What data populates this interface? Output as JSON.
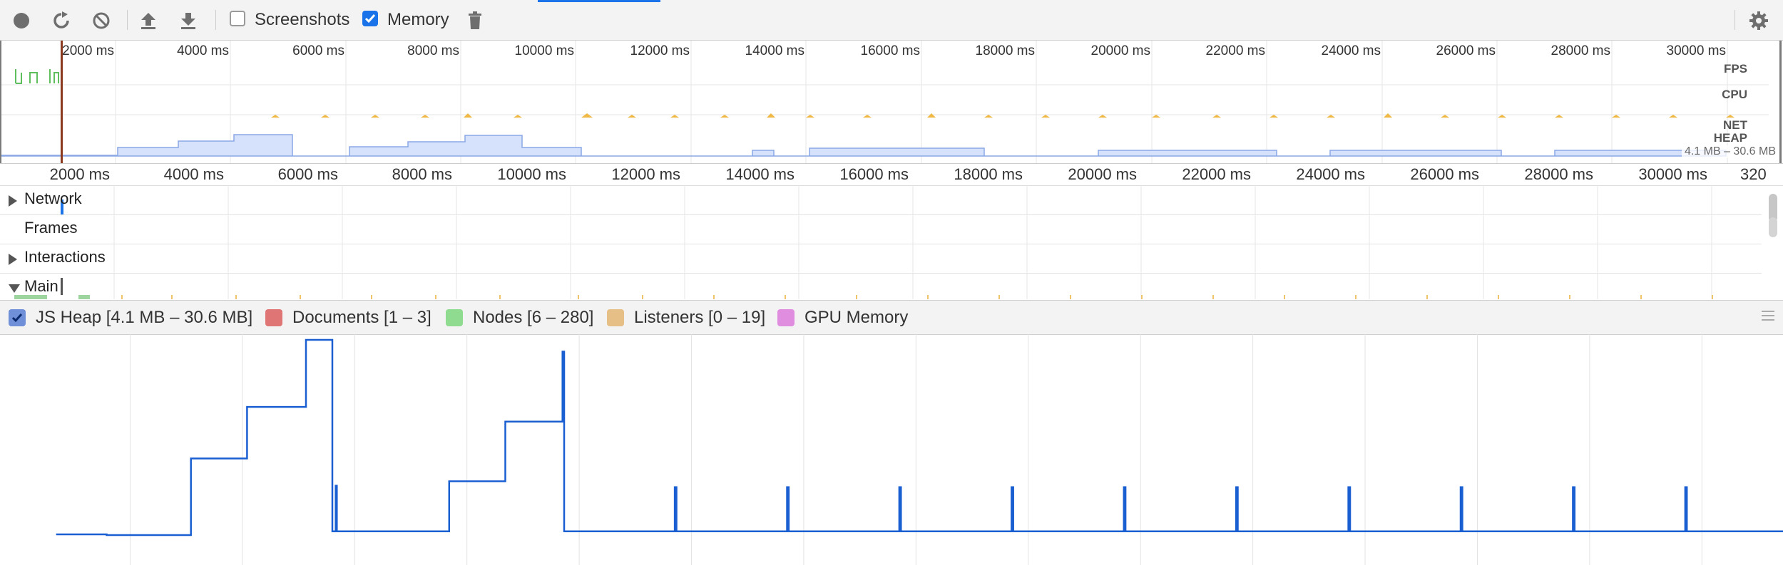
{
  "toolbar": {
    "screenshots_label": "Screenshots",
    "screenshots_checked": false,
    "memory_label": "Memory",
    "memory_checked": true,
    "icons": [
      "record-icon",
      "reload-icon",
      "clear-icon",
      "upload-icon",
      "download-icon",
      "trash-icon",
      "gear-icon"
    ]
  },
  "overview": {
    "ticks": [
      "2000 ms",
      "4000 ms",
      "6000 ms",
      "8000 ms",
      "10000 ms",
      "12000 ms",
      "14000 ms",
      "16000 ms",
      "18000 ms",
      "20000 ms",
      "22000 ms",
      "24000 ms",
      "26000 ms",
      "28000 ms",
      "30000 ms"
    ],
    "lanes": [
      "FPS",
      "CPU",
      "NET",
      "HEAP"
    ],
    "heap_range": "4.1 MB – 30.6 MB"
  },
  "timeline": {
    "ticks": [
      "2000 ms",
      "4000 ms",
      "6000 ms",
      "8000 ms",
      "10000 ms",
      "12000 ms",
      "14000 ms",
      "16000 ms",
      "18000 ms",
      "20000 ms",
      "22000 ms",
      "24000 ms",
      "26000 ms",
      "28000 ms",
      "30000 ms",
      "320"
    ],
    "tracks": [
      {
        "label": "Network",
        "expand": "collapsed"
      },
      {
        "label": "Frames",
        "expand": "none"
      },
      {
        "label": "Interactions",
        "expand": "collapsed"
      },
      {
        "label": "Main",
        "expand": "expanded"
      }
    ]
  },
  "counters": {
    "items": [
      {
        "label": "JS Heap [4.1 MB – 30.6 MB]",
        "color": "#1a5fd1",
        "checked": true
      },
      {
        "label": "Documents [1 – 3]",
        "color": "#e07575",
        "checked": false
      },
      {
        "label": "Nodes [6 – 280]",
        "color": "#8fdb8f",
        "checked": false
      },
      {
        "label": "Listeners [0 – 19]",
        "color": "#e6bf86",
        "checked": false
      },
      {
        "label": "GPU Memory",
        "color": "#e08ddf",
        "checked": false
      }
    ]
  },
  "chart_data": {
    "type": "line",
    "title": "",
    "xlabel": "",
    "ylabel": "",
    "series": [
      {
        "name": "JS Heap",
        "x": [
          1000,
          1800,
          1900,
          3400,
          3401,
          4400,
          4401,
          5450,
          5451,
          5900,
          5920,
          5980,
          6000,
          8000,
          8001,
          9000,
          9001,
          10000,
          10020,
          10050,
          10080,
          12000,
          12020,
          12050,
          12080,
          14000,
          14020,
          14050,
          14080,
          16000,
          16020,
          16050,
          16080,
          18000,
          18020,
          18050,
          18080,
          20000,
          20020,
          20050,
          20080,
          22000,
          22020,
          22050,
          22080,
          24000,
          24020,
          24050,
          24080,
          26000,
          26020,
          26050,
          26080,
          28000,
          28020,
          28050,
          28080,
          30000,
          30020,
          30050,
          30080,
          32000
        ],
        "values": [
          4.2,
          4.2,
          4.1,
          4.1,
          14.5,
          14.5,
          21.5,
          21.5,
          30.6,
          30.6,
          4.6,
          10.8,
          4.6,
          4.6,
          11.4,
          11.4,
          19.5,
          19.5,
          29.0,
          4.6,
          4.6,
          4.6,
          10.6,
          4.6,
          4.6,
          4.6,
          10.6,
          4.6,
          4.6,
          4.6,
          10.6,
          4.6,
          4.6,
          4.6,
          10.6,
          4.6,
          4.6,
          4.6,
          10.6,
          4.6,
          4.6,
          4.6,
          10.6,
          4.6,
          4.6,
          4.6,
          10.6,
          4.6,
          4.6,
          4.6,
          10.6,
          4.6,
          4.6,
          4.6,
          10.6,
          4.6,
          4.6,
          4.6,
          10.6,
          4.6,
          4.6,
          4.6
        ]
      }
    ],
    "ylim": [
      4.1,
      30.6
    ],
    "xlim": [
      0,
      31000
    ]
  }
}
